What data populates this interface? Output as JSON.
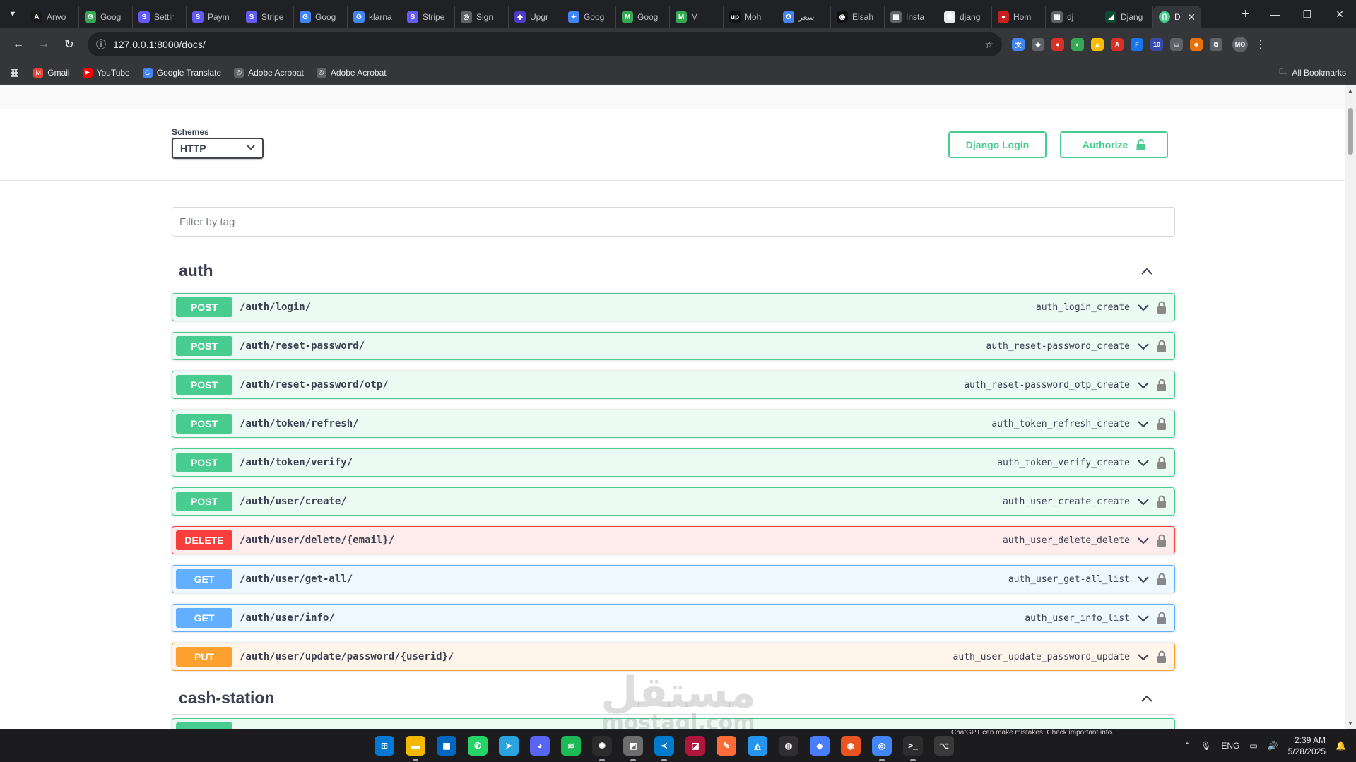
{
  "browser": {
    "tabs": [
      {
        "title": "Anvo",
        "color": "#1a1a1a",
        "glyph": "A"
      },
      {
        "title": "Goog",
        "color": "#34a853",
        "glyph": "G"
      },
      {
        "title": "Settir",
        "color": "#635bff",
        "glyph": "S"
      },
      {
        "title": "Paym",
        "color": "#635bff",
        "glyph": "S"
      },
      {
        "title": "Stripe",
        "color": "#635bff",
        "glyph": "S"
      },
      {
        "title": "Goog",
        "color": "#4285f4",
        "glyph": "G"
      },
      {
        "title": "klarna",
        "color": "#4285f4",
        "glyph": "G"
      },
      {
        "title": "Stripe",
        "color": "#635bff",
        "glyph": "S"
      },
      {
        "title": "Sign",
        "color": "#5f6368",
        "glyph": "◎"
      },
      {
        "title": "Upgr",
        "color": "#4b3cc9",
        "glyph": "◆"
      },
      {
        "title": "Goog",
        "color": "#4285f4",
        "glyph": "✦"
      },
      {
        "title": "Goog",
        "color": "#34a853",
        "glyph": "M"
      },
      {
        "title": "M",
        "color": "#34a853",
        "glyph": "M"
      },
      {
        "title": "Moh",
        "color": "#111111",
        "glyph": "up"
      },
      {
        "title": "سعر",
        "color": "#4285f4",
        "glyph": "G"
      },
      {
        "title": "Elsah",
        "color": "#111111",
        "glyph": "◉"
      },
      {
        "title": "Insta",
        "color": "#5f6368",
        "glyph": "▦"
      },
      {
        "title": "djang",
        "color": "#e8eaed",
        "glyph": "⬢"
      },
      {
        "title": "Hom",
        "color": "#c5221f",
        "glyph": "●"
      },
      {
        "title": "dj",
        "color": "#5f6368",
        "glyph": "▦"
      },
      {
        "title": "Djang",
        "color": "#0c4b33",
        "glyph": "◢"
      }
    ],
    "active_tab": {
      "title": "D",
      "color": "#49cc90",
      "glyph": "{}"
    },
    "url": "127.0.0.1:8000/docs/",
    "bookmarks": [
      {
        "label": "Gmail",
        "color": "#ea4335",
        "glyph": "M"
      },
      {
        "label": "YouTube",
        "color": "#ff0000",
        "glyph": "▶"
      },
      {
        "label": "Google Translate",
        "color": "#4285f4",
        "glyph": "G"
      },
      {
        "label": "Adobe Acrobat",
        "color": "#5f6368",
        "glyph": "◎"
      },
      {
        "label": "Adobe Acrobat",
        "color": "#5f6368",
        "glyph": "◎"
      }
    ],
    "all_bookmarks": "All Bookmarks",
    "extensions": [
      {
        "color": "#4285f4",
        "glyph": "文"
      },
      {
        "color": "#5f6368",
        "glyph": "◈"
      },
      {
        "color": "#d93025",
        "glyph": "●"
      },
      {
        "color": "#34a853",
        "glyph": "◐"
      },
      {
        "color": "#fbbc04",
        "glyph": "▲"
      },
      {
        "color": "#d93025",
        "glyph": "A"
      },
      {
        "color": "#1a73e8",
        "glyph": "F"
      },
      {
        "color": "#3949ab",
        "glyph": "10"
      },
      {
        "color": "#5f6368",
        "glyph": "▭"
      },
      {
        "color": "#e8710a",
        "glyph": "☻"
      },
      {
        "color": "#5f6368",
        "glyph": "⧉"
      }
    ],
    "profile": "MO"
  },
  "swagger": {
    "schemes_label": "Schemes",
    "scheme_value": "HTTP",
    "django_login": "Django Login",
    "authorize": "Authorize",
    "filter_placeholder": "Filter by tag",
    "tags": [
      {
        "name": "auth"
      },
      {
        "name": "cash-station"
      }
    ],
    "operations": [
      {
        "method": "POST",
        "type": "post",
        "path": "/auth/login/",
        "id": "auth_login_create"
      },
      {
        "method": "POST",
        "type": "post",
        "path": "/auth/reset-password/",
        "id": "auth_reset-password_create"
      },
      {
        "method": "POST",
        "type": "post",
        "path": "/auth/reset-password/otp/",
        "id": "auth_reset-password_otp_create"
      },
      {
        "method": "POST",
        "type": "post",
        "path": "/auth/token/refresh/",
        "id": "auth_token_refresh_create"
      },
      {
        "method": "POST",
        "type": "post",
        "path": "/auth/token/verify/",
        "id": "auth_token_verify_create"
      },
      {
        "method": "POST",
        "type": "post",
        "path": "/auth/user/create/",
        "id": "auth_user_create_create"
      },
      {
        "method": "DELETE",
        "type": "delete",
        "path": "/auth/user/delete/{email}/",
        "id": "auth_user_delete_delete"
      },
      {
        "method": "GET",
        "type": "get",
        "path": "/auth/user/get-all/",
        "id": "auth_user_get-all_list"
      },
      {
        "method": "GET",
        "type": "get",
        "path": "/auth/user/info/",
        "id": "auth_user_info_list"
      },
      {
        "method": "PUT",
        "type": "put",
        "path": "/auth/user/update/password/{userid}/",
        "id": "auth_user_update_password_update"
      }
    ]
  },
  "watermark": {
    "arabic": "مستقل",
    "latin": "mostaql.com"
  },
  "taskbar": {
    "notice": "ChatGPT can make mistakes. Check important info.",
    "apps": [
      {
        "name": "windows-start",
        "color": "#0078d4",
        "glyph": "⊞",
        "running": false
      },
      {
        "name": "file-explorer",
        "color": "#f2b800",
        "glyph": "▬",
        "running": true
      },
      {
        "name": "store",
        "color": "#0067c0",
        "glyph": "▣",
        "running": false
      },
      {
        "name": "whatsapp",
        "color": "#25d366",
        "glyph": "✆",
        "running": false
      },
      {
        "name": "telegram",
        "color": "#2aa3df",
        "glyph": "➤",
        "running": false
      },
      {
        "name": "discord",
        "color": "#5865f2",
        "glyph": "◕",
        "running": false
      },
      {
        "name": "spotify",
        "color": "#1db954",
        "glyph": "≋",
        "running": false
      },
      {
        "name": "chatgpt",
        "color": "#2b2b2b",
        "glyph": "✺",
        "running": true
      },
      {
        "name": "pdf-app",
        "color": "#6d6d6d",
        "glyph": "◩",
        "running": true
      },
      {
        "name": "vscode",
        "color": "#007acc",
        "glyph": "≺",
        "running": true
      },
      {
        "name": "intellij",
        "color": "#b0153b",
        "glyph": "◪",
        "running": false
      },
      {
        "name": "postman",
        "color": "#ff6c37",
        "glyph": "✎",
        "running": false
      },
      {
        "name": "docker",
        "color": "#2496ed",
        "glyph": "◭",
        "running": false
      },
      {
        "name": "obs",
        "color": "#302e31",
        "glyph": "◍",
        "running": false
      },
      {
        "name": "notes",
        "color": "#4a7dfc",
        "glyph": "◆",
        "running": false
      },
      {
        "name": "ubuntu",
        "color": "#e95420",
        "glyph": "◉",
        "running": false
      },
      {
        "name": "chrome",
        "color": "#4285f4",
        "glyph": "◎",
        "running": true
      },
      {
        "name": "terminal",
        "color": "#2d2d2d",
        "glyph": ">_",
        "running": true
      },
      {
        "name": "git-client",
        "color": "#3a3a3a",
        "glyph": "⌥",
        "running": false
      }
    ],
    "language": "ENG",
    "time": "2:39 AM",
    "date": "5/28/2025"
  }
}
